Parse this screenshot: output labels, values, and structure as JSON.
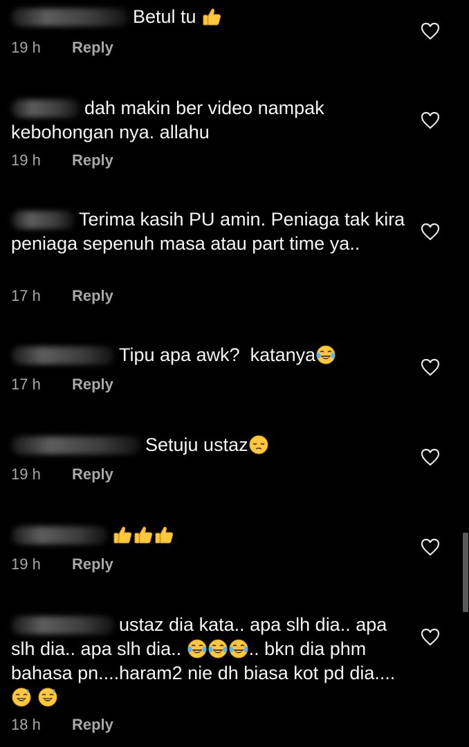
{
  "comments": [
    {
      "text": "Betul tu",
      "time": "19 h",
      "reply": "Reply"
    },
    {
      "text": "dah makin ber video nampak kebohongan nya. allahu",
      "time": "19 h",
      "reply": "Reply"
    },
    {
      "text": "Terima kasih PU amin. Peniaga tak kira peniaga sepenuh masa atau part time ya..",
      "time": "17 h",
      "reply": "Reply"
    },
    {
      "text_a": "Tipu apa awk?",
      "text_b": "katanya",
      "time": "17 h",
      "reply": "Reply"
    },
    {
      "text": "Setuju ustaz",
      "time": "19 h",
      "reply": "Reply"
    },
    {
      "time": "19 h",
      "reply": "Reply"
    },
    {
      "text_a": "ustaz dia kata.. apa slh dia.. apa slh dia.. apa slh dia..",
      "text_b": ".. bkn dia phm bahasa pn....haram2 nie dh biasa kot pd dia....",
      "time": "18 h",
      "reply": "Reply"
    }
  ],
  "icons": {
    "like": "heart-outline-icon",
    "thumbs_up": "thumbs-up-emoji",
    "laughing": "face-with-tears-of-joy-emoji",
    "pensive": "pensive-face-emoji",
    "sweat_smile": "grinning-face-with-sweat-emoji"
  },
  "colors": {
    "background": "#000000",
    "text": "#f5f5f5",
    "meta": "#a8a8a8",
    "emoji_yellow": "#ffc83d"
  }
}
